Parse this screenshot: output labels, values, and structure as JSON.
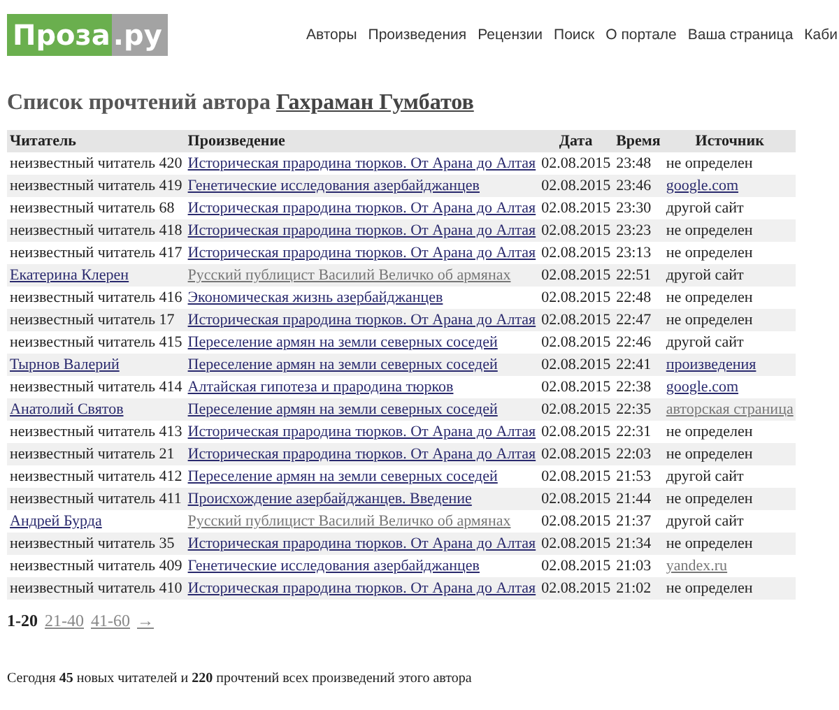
{
  "logo": {
    "left": "Проза",
    "right": ".ру"
  },
  "nav": [
    "Авторы",
    "Произведения",
    "Рецензии",
    "Поиск",
    "О портале",
    "Ваша страница",
    "Каби"
  ],
  "heading": {
    "text": "Список прочтений автора",
    "author": "Гахраман Гумбатов"
  },
  "table": {
    "columns": [
      "Читатель",
      "Произведение",
      "Дата",
      "Время",
      "Источник"
    ],
    "rows": [
      {
        "reader": {
          "text": "неизвестный читатель 420",
          "kind": "text"
        },
        "work": {
          "text": "Историческая прародина тюрков. От Арана до Алтая",
          "kind": "link"
        },
        "date": "02.08.2015",
        "time": "23:48",
        "source": {
          "text": "не определен",
          "kind": "text"
        }
      },
      {
        "reader": {
          "text": "неизвестный читатель 419",
          "kind": "text"
        },
        "work": {
          "text": "Генетические исследования азербайджанцев",
          "kind": "link"
        },
        "date": "02.08.2015",
        "time": "23:46",
        "source": {
          "text": "google.com",
          "kind": "link"
        }
      },
      {
        "reader": {
          "text": "неизвестный читатель 68",
          "kind": "text"
        },
        "work": {
          "text": "Историческая прародина тюрков. От Арана до Алтая",
          "kind": "link"
        },
        "date": "02.08.2015",
        "time": "23:30",
        "source": {
          "text": "другой сайт",
          "kind": "text"
        }
      },
      {
        "reader": {
          "text": "неизвестный читатель 418",
          "kind": "text"
        },
        "work": {
          "text": "Историческая прародина тюрков. От Арана до Алтая",
          "kind": "link"
        },
        "date": "02.08.2015",
        "time": "23:23",
        "source": {
          "text": "не определен",
          "kind": "text"
        }
      },
      {
        "reader": {
          "text": "неизвестный читатель 417",
          "kind": "text"
        },
        "work": {
          "text": "Историческая прародина тюрков. От Арана до Алтая",
          "kind": "link"
        },
        "date": "02.08.2015",
        "time": "23:13",
        "source": {
          "text": "не определен",
          "kind": "text"
        }
      },
      {
        "reader": {
          "text": "Екатерина Клерен",
          "kind": "link"
        },
        "work": {
          "text": "Русский публицист Василий Величко об армянах",
          "kind": "visited"
        },
        "date": "02.08.2015",
        "time": "22:51",
        "source": {
          "text": "другой сайт",
          "kind": "text"
        }
      },
      {
        "reader": {
          "text": "неизвестный читатель 416",
          "kind": "text"
        },
        "work": {
          "text": "Экономическая жизнь азербайджанцев",
          "kind": "link"
        },
        "date": "02.08.2015",
        "time": "22:48",
        "source": {
          "text": "не определен",
          "kind": "text"
        }
      },
      {
        "reader": {
          "text": "неизвестный читатель 17",
          "kind": "text"
        },
        "work": {
          "text": "Историческая прародина тюрков. От Арана до Алтая",
          "kind": "link"
        },
        "date": "02.08.2015",
        "time": "22:47",
        "source": {
          "text": "не определен",
          "kind": "text"
        }
      },
      {
        "reader": {
          "text": "неизвестный читатель 415",
          "kind": "text"
        },
        "work": {
          "text": "Переселение армян на земли северных соседей",
          "kind": "link"
        },
        "date": "02.08.2015",
        "time": "22:46",
        "source": {
          "text": "другой сайт",
          "kind": "text"
        }
      },
      {
        "reader": {
          "text": "Тырнов Валерий",
          "kind": "link"
        },
        "work": {
          "text": "Переселение армян на земли северных соседей",
          "kind": "link"
        },
        "date": "02.08.2015",
        "time": "22:41",
        "source": {
          "text": "произведения",
          "kind": "link"
        }
      },
      {
        "reader": {
          "text": "неизвестный читатель 414",
          "kind": "text"
        },
        "work": {
          "text": "Алтайская гипотеза и прародина тюрков",
          "kind": "link"
        },
        "date": "02.08.2015",
        "time": "22:38",
        "source": {
          "text": "google.com",
          "kind": "link"
        }
      },
      {
        "reader": {
          "text": "Анатолий Святов",
          "kind": "link"
        },
        "work": {
          "text": "Переселение армян на земли северных соседей",
          "kind": "link"
        },
        "date": "02.08.2015",
        "time": "22:35",
        "source": {
          "text": "авторская страница",
          "kind": "visited"
        }
      },
      {
        "reader": {
          "text": "неизвестный читатель 413",
          "kind": "text"
        },
        "work": {
          "text": "Историческая прародина тюрков. От Арана до Алтая",
          "kind": "link"
        },
        "date": "02.08.2015",
        "time": "22:31",
        "source": {
          "text": "не определен",
          "kind": "text"
        }
      },
      {
        "reader": {
          "text": "неизвестный читатель 21",
          "kind": "text"
        },
        "work": {
          "text": "Историческая прародина тюрков. От Арана до Алтая",
          "kind": "link"
        },
        "date": "02.08.2015",
        "time": "22:03",
        "source": {
          "text": "не определен",
          "kind": "text"
        }
      },
      {
        "reader": {
          "text": "неизвестный читатель 412",
          "kind": "text"
        },
        "work": {
          "text": "Переселение армян на земли северных соседей",
          "kind": "link"
        },
        "date": "02.08.2015",
        "time": "21:53",
        "source": {
          "text": "другой сайт",
          "kind": "text"
        }
      },
      {
        "reader": {
          "text": "неизвестный читатель 411",
          "kind": "text"
        },
        "work": {
          "text": "Происхождение азербайджанцев. Введение",
          "kind": "link"
        },
        "date": "02.08.2015",
        "time": "21:44",
        "source": {
          "text": "не определен",
          "kind": "text"
        }
      },
      {
        "reader": {
          "text": "Андрей Бурда",
          "kind": "link"
        },
        "work": {
          "text": "Русский публицист Василий Величко об армянах",
          "kind": "visited"
        },
        "date": "02.08.2015",
        "time": "21:37",
        "source": {
          "text": "другой сайт",
          "kind": "text"
        }
      },
      {
        "reader": {
          "text": "неизвестный читатель 35",
          "kind": "text"
        },
        "work": {
          "text": "Историческая прародина тюрков. От Арана до Алтая",
          "kind": "link"
        },
        "date": "02.08.2015",
        "time": "21:34",
        "source": {
          "text": "не определен",
          "kind": "text"
        }
      },
      {
        "reader": {
          "text": "неизвестный читатель 409",
          "kind": "text"
        },
        "work": {
          "text": "Генетические исследования азербайджанцев",
          "kind": "link"
        },
        "date": "02.08.2015",
        "time": "21:03",
        "source": {
          "text": "yandex.ru",
          "kind": "visited"
        }
      },
      {
        "reader": {
          "text": "неизвестный читатель 410",
          "kind": "text"
        },
        "work": {
          "text": "Историческая прародина тюрков. От Арана до Алтая",
          "kind": "link"
        },
        "date": "02.08.2015",
        "time": "21:02",
        "source": {
          "text": "не определен",
          "kind": "text"
        }
      }
    ]
  },
  "pagination": [
    {
      "label": "1-20",
      "selected": true
    },
    {
      "label": "21-40",
      "selected": false
    },
    {
      "label": "41-60",
      "selected": false
    },
    {
      "label": "→",
      "selected": false
    }
  ],
  "footer": "Сегодня **45** новых читателей и **220** прочтений всех произведений этого автора"
}
